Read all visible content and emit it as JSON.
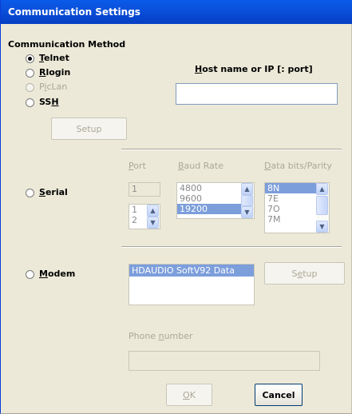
{
  "window": {
    "title": "Communication Settings"
  },
  "method": {
    "heading": "Communication Method",
    "telnet": {
      "pre": "",
      "mn": "T",
      "post": "elnet"
    },
    "rlogin": {
      "pre": "",
      "mn": "R",
      "post": "login"
    },
    "piclan": {
      "pre": "P",
      "mn": "i",
      "post": "cLan"
    },
    "ssh": {
      "pre": "SS",
      "mn": "H",
      "post": ""
    },
    "setup_label": "Setup"
  },
  "host": {
    "pre": "",
    "mn": "H",
    "post": "ost name or IP [: port]",
    "value": ""
  },
  "serial": {
    "radio": {
      "pre": "",
      "mn": "S",
      "post": "erial"
    },
    "port_header": {
      "pre": "",
      "mn": "P",
      "post": "ort"
    },
    "baud_header": {
      "pre": "",
      "mn": "B",
      "post": "aud Rate"
    },
    "data_header": {
      "pre": "",
      "mn": "D",
      "post": "ata bits/Parity"
    },
    "port_value": "1",
    "port_options": [
      "1",
      "2"
    ],
    "baud_options": [
      "4800",
      "9600",
      "19200"
    ],
    "baud_selected": "19200",
    "data_options": [
      "8N",
      "7E",
      "7O",
      "7M"
    ],
    "data_selected": "8N"
  },
  "modem": {
    "radio": {
      "pre": "",
      "mn": "M",
      "post": "odem"
    },
    "list_items": [
      "HDAUDIO SoftV92 Data"
    ],
    "setup": {
      "pre": "S",
      "mn": "e",
      "post": "tup"
    },
    "phone_label": {
      "pre": "Phone ",
      "mn": "n",
      "post": "umber"
    },
    "phone_value": ""
  },
  "footer": {
    "ok": {
      "pre": "",
      "mn": "O",
      "post": "K"
    },
    "cancel": "Cancel"
  },
  "colors": {
    "title_bar": "#0b52de",
    "dialog_bg": "#ece9d8",
    "selection": "#316ac5"
  }
}
